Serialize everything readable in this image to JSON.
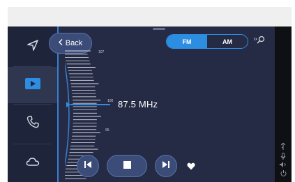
{
  "header": {
    "back_label": "Back"
  },
  "band": {
    "fm_label": "FM",
    "am_label": "AM",
    "selected": "FM"
  },
  "tuner": {
    "frequency_display": "87.5 MHz",
    "scale_labels": {
      "top": "107",
      "middle": "100",
      "lower": "95"
    }
  },
  "sidebar": {
    "items": [
      {
        "id": "navigation",
        "icon": "navigation-arrow-icon",
        "active": false
      },
      {
        "id": "media",
        "icon": "media-play-icon",
        "active": true
      },
      {
        "id": "phone",
        "icon": "phone-icon",
        "active": false
      },
      {
        "id": "cloud",
        "icon": "cloud-icon",
        "active": false
      }
    ]
  },
  "controls": {
    "previous": "skip-previous-icon",
    "stop": "stop-icon",
    "next": "skip-next-icon",
    "favorite": "heart-icon"
  },
  "colors": {
    "accent": "#2d8de0",
    "screen_background": "#252b44",
    "button_fill": "#3c4c78"
  }
}
